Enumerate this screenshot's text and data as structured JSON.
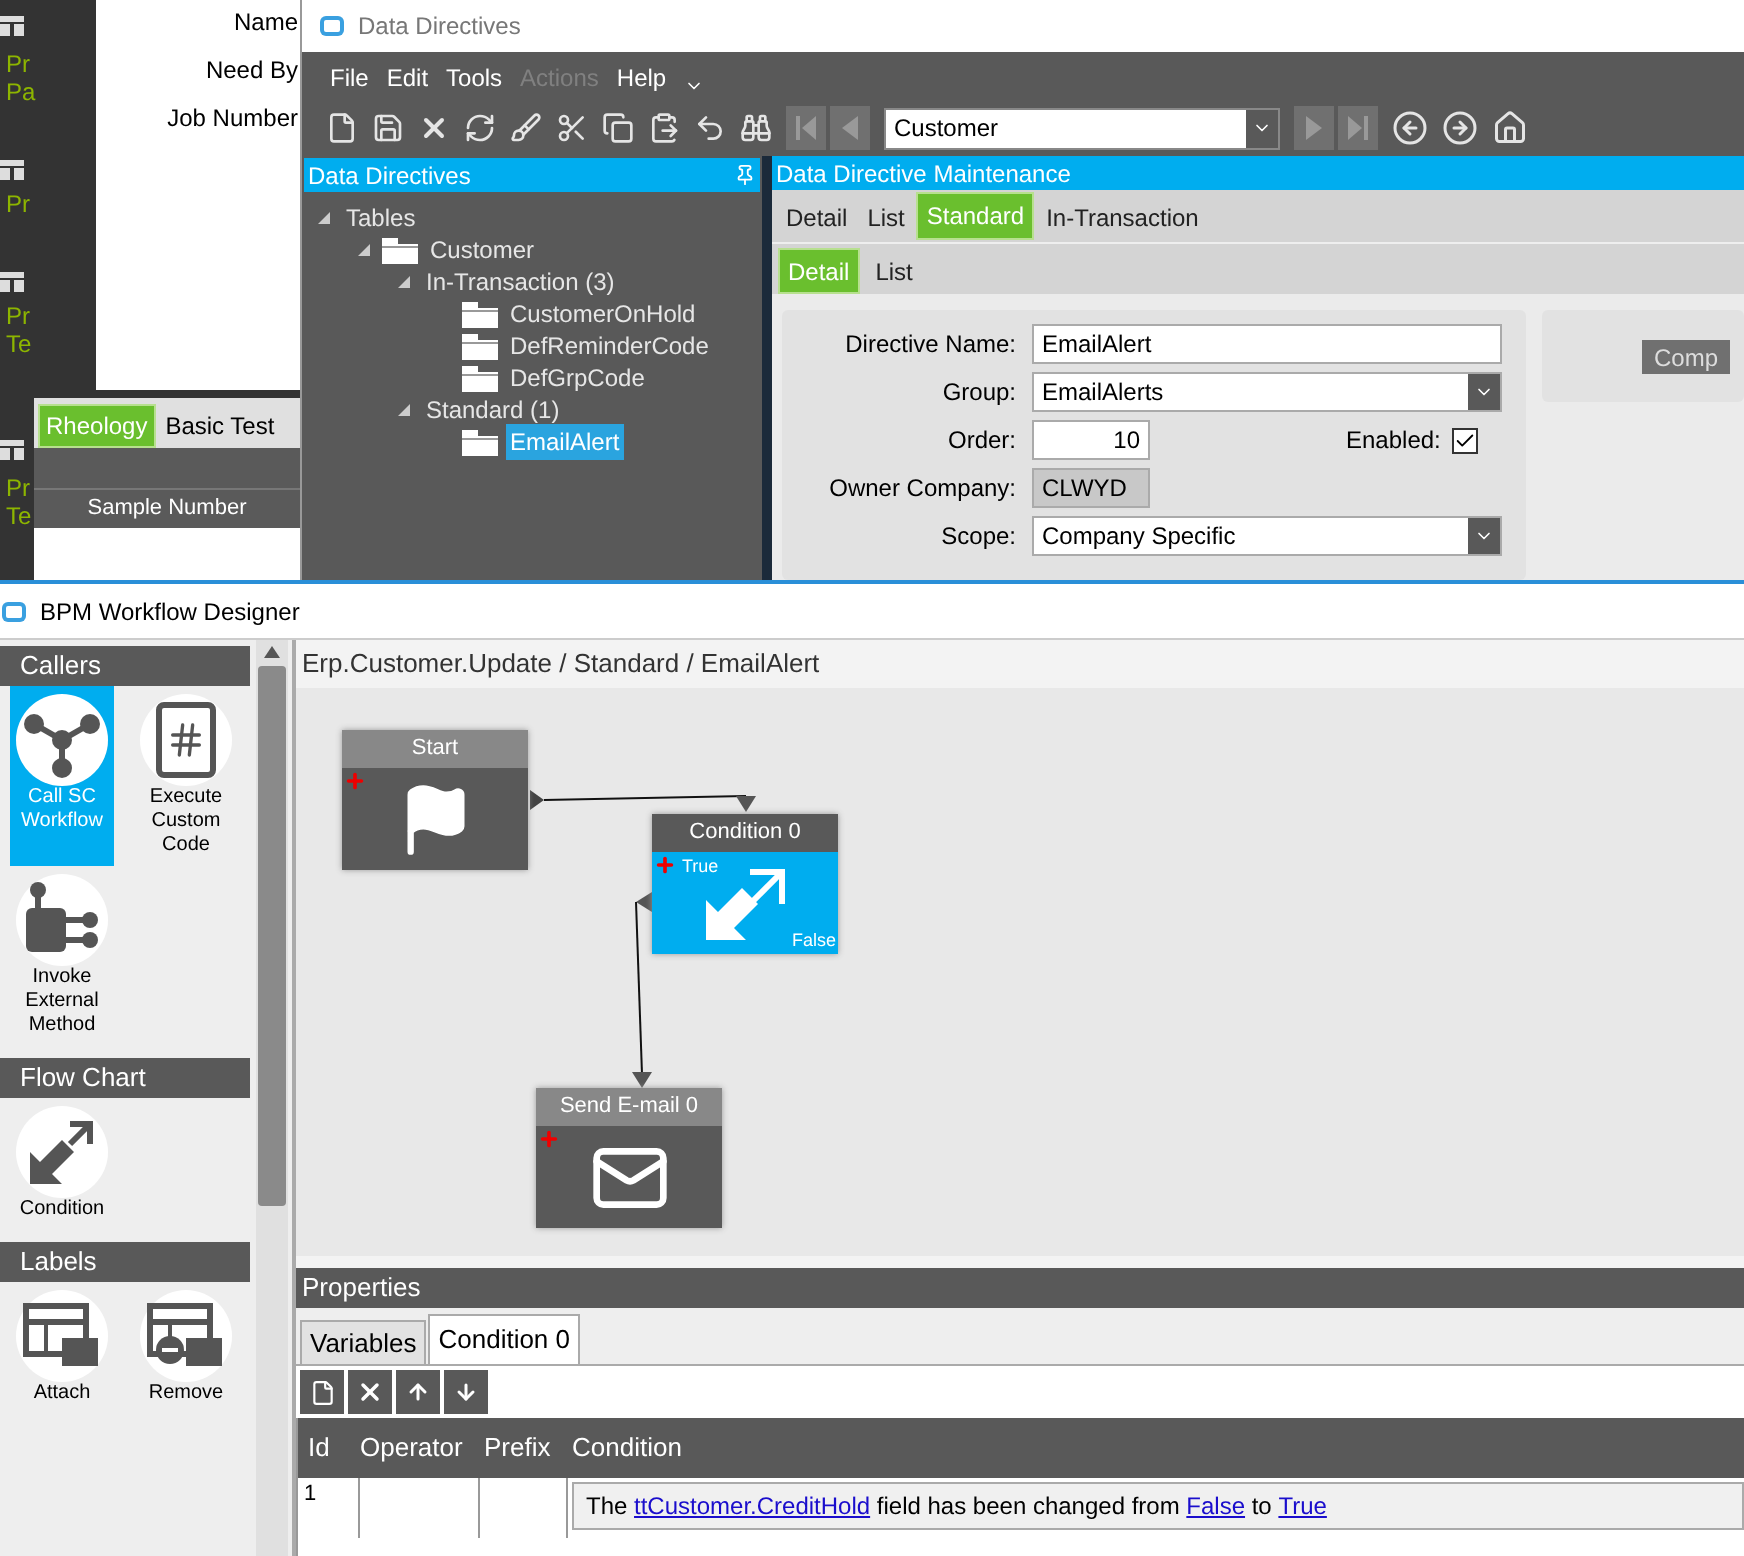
{
  "background_app": {
    "side_texts": [
      "Pr",
      "Pa",
      "Pr",
      "Pr",
      "Te",
      "Pr",
      "Te"
    ],
    "field_labels": [
      "Name",
      "Need By",
      "Job Number"
    ],
    "tabs": [
      {
        "label": "Rheology",
        "selected": true
      },
      {
        "label": "Basic Test",
        "selected": false
      }
    ],
    "column": "Sample Number"
  },
  "data_directives": {
    "window_title": "Data Directives",
    "menu": [
      {
        "label": "File",
        "disabled": false
      },
      {
        "label": "Edit",
        "disabled": false
      },
      {
        "label": "Tools",
        "disabled": false
      },
      {
        "label": "Actions",
        "disabled": true
      },
      {
        "label": "Help",
        "disabled": false
      }
    ],
    "record": "Customer",
    "tree_panel": {
      "title": "Data Directives",
      "tree": [
        {
          "label": "Tables",
          "kind": "group",
          "expanded": true,
          "selected": false,
          "children": [
            {
              "label": "Customer",
              "kind": "folder",
              "expanded": true,
              "selected": false,
              "children": [
                {
                  "label": "In-Transaction (3)",
                  "kind": "group",
                  "expanded": true,
                  "selected": false,
                  "children": [
                    {
                      "label": "CustomerOnHold",
                      "kind": "folder",
                      "selected": false
                    },
                    {
                      "label": "DefReminderCode",
                      "kind": "folder",
                      "selected": false
                    },
                    {
                      "label": "DefGrpCode",
                      "kind": "folder",
                      "selected": false
                    }
                  ]
                },
                {
                  "label": "Standard (1)",
                  "kind": "group",
                  "expanded": true,
                  "selected": false,
                  "children": [
                    {
                      "label": "EmailAlert",
                      "kind": "folder",
                      "selected": true
                    }
                  ]
                }
              ]
            }
          ]
        }
      ]
    },
    "maintenance": {
      "title": "Data Directive Maintenance",
      "tabs": [
        {
          "label": "Detail",
          "selected": false
        },
        {
          "label": "List",
          "selected": false
        },
        {
          "label": "Standard",
          "selected": true
        },
        {
          "label": "In-Transaction",
          "selected": false
        }
      ],
      "subtabs": [
        {
          "label": "Detail",
          "selected": true
        },
        {
          "label": "List",
          "selected": false
        }
      ],
      "fields": [
        {
          "label": "Directive Name:",
          "value": "EmailAlert",
          "kind": "text"
        },
        {
          "label": "Group:",
          "value": "EmailAlerts",
          "kind": "select"
        },
        {
          "label": "Order:",
          "value": "10",
          "kind": "number",
          "checkbox": {
            "label": "Enabled:",
            "checked": true
          }
        },
        {
          "label": "Owner Company:",
          "value": "CLWYD",
          "kind": "readonly"
        },
        {
          "label": "Scope:",
          "value": "Company Specific",
          "kind": "select"
        }
      ],
      "side_button": "Comp"
    }
  },
  "workflow": {
    "window_title": "BPM Workflow Designer",
    "palette": [
      {
        "title": "Callers",
        "items": [
          {
            "label": "Call SC Workflow",
            "kind": "network",
            "selected": true
          },
          {
            "label": "Execute Custom Code",
            "kind": "code",
            "selected": false
          },
          {
            "label": "Invoke External Method",
            "kind": "method",
            "selected": false
          }
        ]
      },
      {
        "title": "Flow Chart",
        "items": [
          {
            "label": "Condition",
            "kind": "condition",
            "selected": false
          }
        ]
      },
      {
        "title": "Labels",
        "items": [
          {
            "label": "Attach",
            "kind": "attach",
            "selected": false
          },
          {
            "label": "Remove",
            "kind": "remove",
            "selected": false
          }
        ]
      }
    ],
    "breadcrumb": "Erp.Customer.Update / Standard / EmailAlert",
    "nodes": [
      {
        "title": "Start",
        "kind": "start",
        "selected": false
      },
      {
        "title": "Condition 0",
        "kind": "condition",
        "selected": true,
        "true_label": "True",
        "false_label": "False"
      },
      {
        "title": "Send E-mail 0",
        "kind": "email",
        "selected": false
      }
    ],
    "properties": {
      "title": "Properties",
      "tabs": [
        {
          "label": "Variables",
          "selected": false
        },
        {
          "label": "Condition 0",
          "selected": true
        }
      ],
      "columns": [
        "Id",
        "Operator",
        "Prefix",
        "Condition"
      ],
      "rows": [
        {
          "id": "1",
          "condition": [
            {
              "text": "The ",
              "link": false
            },
            {
              "text": "ttCustomer.CreditHold",
              "link": true
            },
            {
              "text": " field has been changed from ",
              "link": false
            },
            {
              "text": "False",
              "link": true
            },
            {
              "text": " to ",
              "link": false
            },
            {
              "text": "True",
              "link": true
            }
          ]
        }
      ]
    }
  }
}
